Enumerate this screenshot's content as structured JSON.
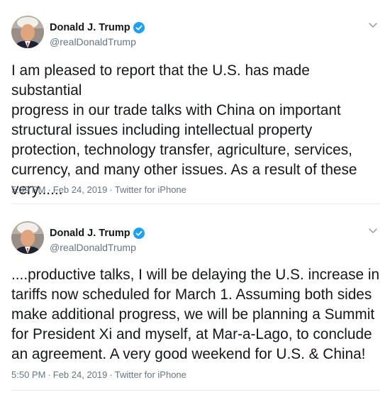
{
  "colors": {
    "verified_badge": "#1da1f2",
    "secondary_text": "#657786",
    "primary_text": "#14171a"
  },
  "tweets": [
    {
      "author": {
        "display_name": "Donald J. Trump",
        "handle": "@realDonaldTrump",
        "verified": true,
        "avatar_icon": "profile-photo"
      },
      "text": "I am pleased to report that the U.S. has made substantial\nprogress in our trade talks with China on important\nstructural issues including intellectual property\nprotection, technology transfer, agriculture, services,\ncurrency, and many other issues. As a result of these\nvery......",
      "time": "5:39 PM",
      "date": "Feb 24, 2019",
      "source": "Twitter for iPhone",
      "menu_icon": "chevron-down-icon"
    },
    {
      "author": {
        "display_name": "Donald J. Trump",
        "handle": "@realDonaldTrump",
        "verified": true,
        "avatar_icon": "profile-photo"
      },
      "text": "....productive talks, I will be delaying the U.S. increase in\ntariffs now scheduled for March 1. Assuming both sides\nmake additional progress, we will be planning a Summit\nfor President Xi and myself, at Mar-a-Lago, to conclude\nan agreement. A very good weekend for U.S. & China!",
      "time": "5:50 PM",
      "date": "Feb 24, 2019",
      "source": "Twitter for iPhone",
      "menu_icon": "chevron-down-icon"
    }
  ]
}
